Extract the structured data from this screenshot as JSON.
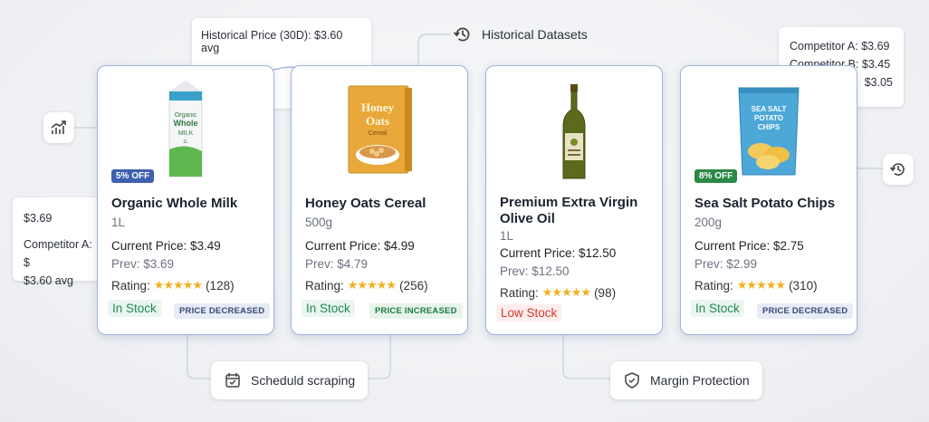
{
  "tooltips": {
    "historical_price": "Historical Price (30D): $3.60 avg",
    "competitors": [
      "Competitor A:  $3.69",
      "Competitor B:  $3.45",
      "$3.05"
    ],
    "left_price": "$3.69",
    "left_competitor": "Competitor A:  $",
    "left_avg": "$3.60 avg"
  },
  "chips": {
    "historical_datasets": "Historical Datasets",
    "schedule_scraping": "Scheduld scraping",
    "margin_protection": "Margin Protection"
  },
  "products": [
    {
      "name": "Organic Whole Milk",
      "size": "1L",
      "current": "Current Price: $3.49",
      "prev": "Prev: $3.69",
      "rating_label": "Rating:",
      "stars": "★★★★★",
      "rating_count": "(128)",
      "stock": "In Stock",
      "tag": "PRICE DECREASED",
      "badge": "5% OFF"
    },
    {
      "name": "Honey Oats Cereal",
      "size": "500g",
      "current": "Current Price: $4.99",
      "prev": "Prev: $4.79",
      "rating_label": "Rating:",
      "stars": "★★★★★",
      "rating_count": "(256)",
      "stock": "In Stock",
      "tag": "PRICE INCREASED"
    },
    {
      "name": "Premium Extra Virgin Olive Oil",
      "size": "1L",
      "current": "Current Price: $12.50",
      "prev": "Prev: $12.50",
      "rating_label": "Rating:",
      "stars": "★★★★★",
      "rating_count": "(98)",
      "stock": "Low Stock"
    },
    {
      "name": "Sea Salt Potato Chips",
      "size": "200g",
      "current": "Current Price: $2.75",
      "prev": "Prev: $2.99",
      "rating_label": "Rating:",
      "stars": "★★★★★",
      "rating_count": "(310)",
      "stock": "In Stock",
      "tag": "PRICE DECREASED",
      "badge": "8% OFF"
    }
  ],
  "packaging": {
    "milk_label": [
      "Organic",
      "Whole",
      "MILK",
      "1L"
    ],
    "oats_label": [
      "Honey",
      "Oats",
      "Cereal"
    ],
    "chips_label": [
      "SEA SALT",
      "POTATO",
      "CHIPS"
    ]
  },
  "colors": {
    "card_border": "#9fb4dc",
    "badge_blue": "#3f5fb0",
    "badge_green": "#2c8a47",
    "in_stock": "#1f8a4c",
    "low_stock": "#d23b2f",
    "star": "#f2b01e"
  },
  "icons": [
    "trend-up-icon",
    "history-icon",
    "calendar-check-icon",
    "shield-check-icon"
  ]
}
